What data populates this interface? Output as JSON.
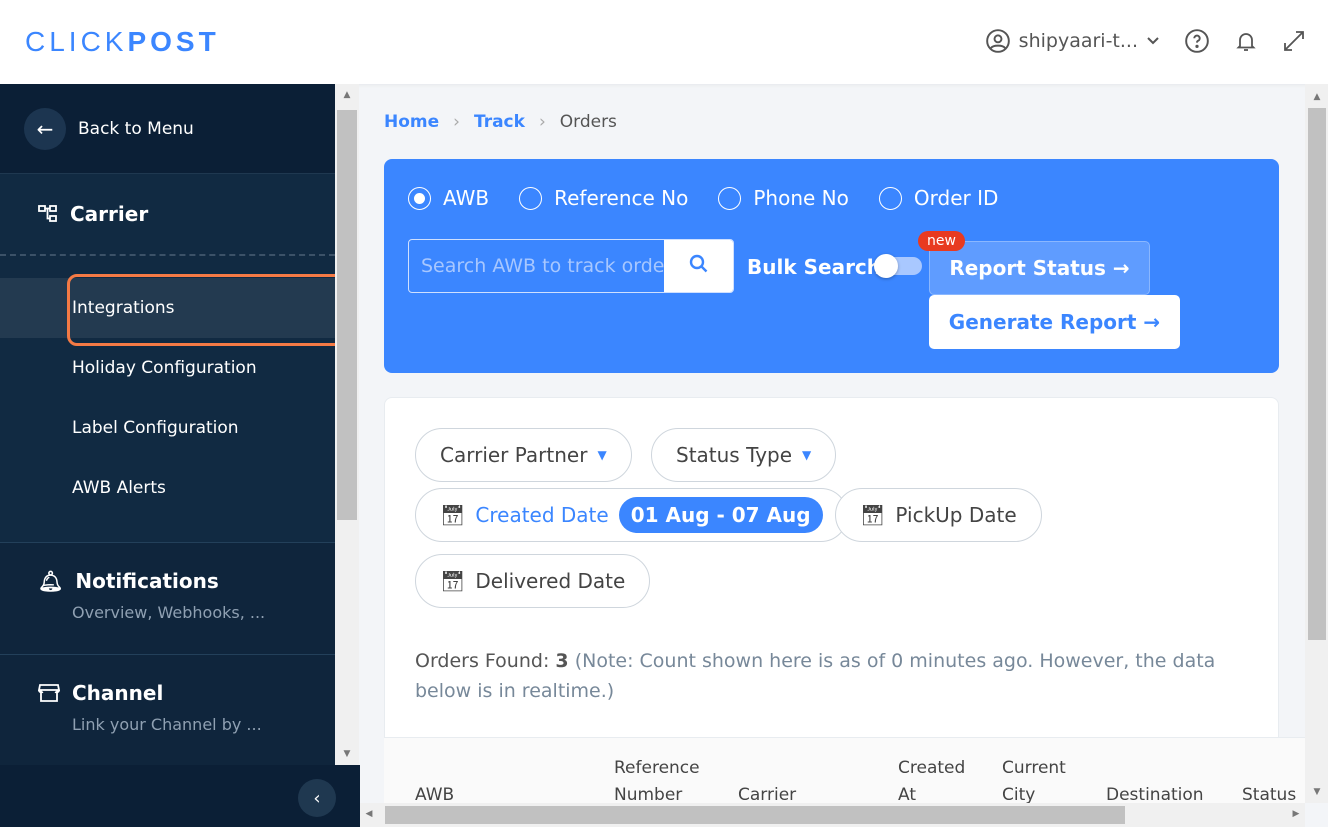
{
  "header": {
    "logo_light": "CLICK",
    "logo_bold": "POST",
    "user": "shipyaari-t..."
  },
  "sidebar": {
    "back": "Back to Menu",
    "section": "Carrier",
    "items": [
      {
        "label": "Integrations"
      },
      {
        "label": "Holiday Configuration"
      },
      {
        "label": "Label Configuration"
      },
      {
        "label": "AWB Alerts"
      }
    ],
    "groups": [
      {
        "title": "Notifications",
        "subtitle": "Overview, Webhooks, ..."
      },
      {
        "title": "Channel",
        "subtitle": "Link your Channel by ..."
      }
    ]
  },
  "breadcrumb": {
    "home": "Home",
    "track": "Track",
    "current": "Orders"
  },
  "search": {
    "options": [
      "AWB",
      "Reference No",
      "Phone No",
      "Order ID"
    ],
    "selected": "AWB",
    "placeholder": "Search AWB to track order",
    "bulk": "Bulk Search",
    "report_status": "Report Status →",
    "badge": "new",
    "generate": "Generate Report →"
  },
  "filters": {
    "carrier": "Carrier Partner",
    "status": "Status Type",
    "created": "Created Date",
    "created_range": "01 Aug - 07 Aug",
    "pickup": "PickUp Date",
    "delivered": "Delivered Date"
  },
  "orders": {
    "label": "Orders Found:",
    "count": "3",
    "note": "(Note: Count shown here is as of 0 minutes ago. However, the data below is in realtime.)"
  },
  "table": {
    "columns": [
      "AWB",
      "Reference Number",
      "Carrier",
      "Created At",
      "Current City",
      "Destination",
      "Status"
    ]
  },
  "colors": {
    "accent": "#3b86ff",
    "sidebar": "#112a42",
    "highlight": "#f47a45"
  }
}
